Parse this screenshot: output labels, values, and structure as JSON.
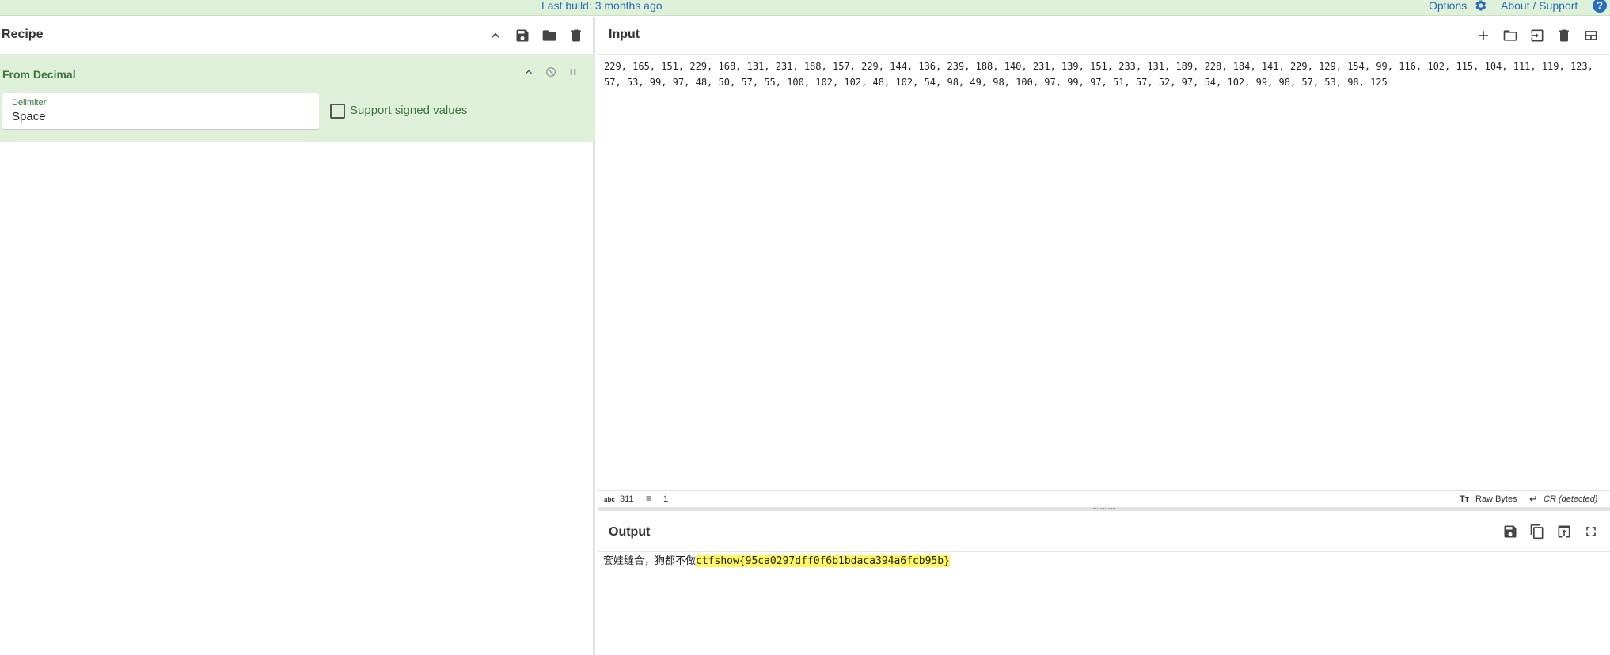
{
  "banner": {
    "build_text": "Last build: 3 months ago",
    "options_label": "Options",
    "about_label": "About / Support",
    "help_glyph": "?"
  },
  "recipe": {
    "title": "Recipe",
    "icons": [
      "collapse-all-icon",
      "save-icon",
      "folder-icon",
      "trash-icon"
    ],
    "operation": {
      "name": "From Decimal",
      "delimiter_label": "Delimiter",
      "delimiter_value": "Space",
      "signed_label": "Support signed values",
      "signed_checked": false
    }
  },
  "input": {
    "title": "Input",
    "icons": [
      "add-icon",
      "folder-icon",
      "sign-in-icon",
      "trash-icon",
      "layout-icon"
    ],
    "text": "229, 165, 151, 229, 168, 131, 231, 188, 157, 229, 144, 136, 239, 188, 140, 231, 139, 151, 233, 131, 189, 228, 184, 141, 229, 129, 154, 99, 116, 102, 115, 104, 111, 119, 123, 57, 53, 99, 97, 48, 50, 57, 55, 100, 102, 102, 48, 102, 54, 98, 49, 98, 100, 97, 99, 97, 51, 57, 52, 97, 54, 102, 99, 98, 57, 53, 98, 125",
    "status": {
      "chars_label": "abc",
      "chars_value": "311",
      "lines_value": "1",
      "format_label": "Raw Bytes",
      "eol_label": "CR (detected)"
    }
  },
  "output": {
    "title": "Output",
    "icons": [
      "save-icon",
      "copy-icon",
      "move-to-input-icon",
      "maximize-icon"
    ],
    "text_plain": "套娃缝合，狗都不做",
    "text_highlight": "ctfshow{95ca0297dff0f6b1bdaca394a6fcb95b}"
  },
  "colors": {
    "banner_bg": "#dff0d8",
    "operation_bg": "#dff0d8",
    "operation_text": "#3c763d",
    "link": "#2a6ebb",
    "highlight": "#fef75d"
  }
}
